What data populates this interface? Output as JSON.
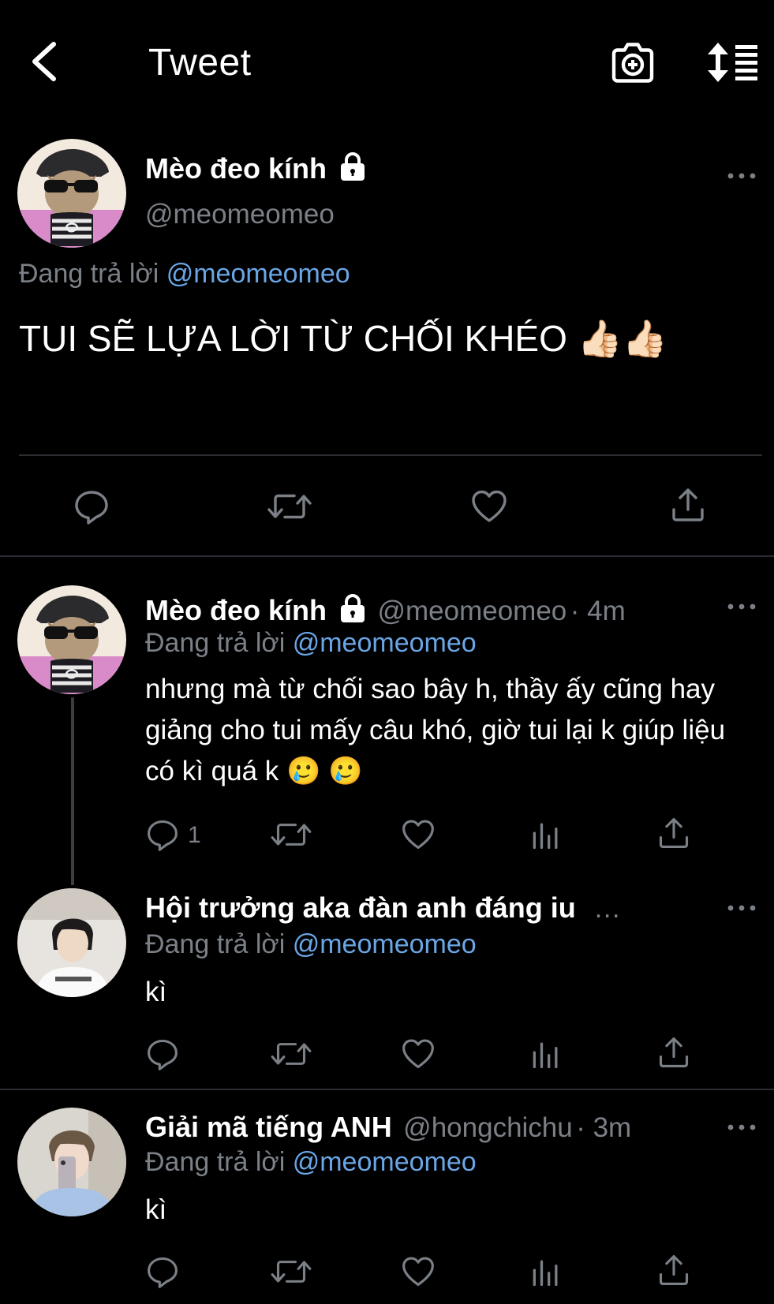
{
  "header": {
    "title": "Tweet"
  },
  "main_tweet": {
    "display_name": "Mèo đeo kính",
    "handle": "@meomeomeo",
    "reply_prefix": "Đang trả lời",
    "reply_to": "@meomeomeo",
    "text": "TUI SẼ LỰA LỜI TỪ CHỐI KHÉO 👍🏻👍🏻"
  },
  "replies": [
    {
      "display_name": "Mèo đeo kính",
      "handle": "@meomeomeo",
      "time": "· 4m",
      "reply_prefix": "Đang trả lời",
      "reply_to": "@meomeomeo",
      "text": "nhưng mà từ chối sao bây h, thầy ấy cũng hay giảng cho tui mấy câu khó, giờ tui lại k giúp liệu có kì quá k 🥲 🥲",
      "reply_count": "1"
    },
    {
      "display_name": "Hội trưởng aka đàn anh đáng iu",
      "truncation": "…",
      "reply_prefix": "Đang trả lời",
      "reply_to": "@meomeomeo",
      "text": "kì"
    },
    {
      "display_name": "Giải mã tiếng ANH",
      "handle": "@hongchichu",
      "time": "· 3m",
      "reply_prefix": "Đang trả lời",
      "reply_to": "@meomeomeo",
      "text": "kì"
    }
  ],
  "icons": [
    "back-icon",
    "camera-add-icon",
    "sort-icon",
    "lock-icon",
    "more-icon",
    "reply-icon",
    "retweet-icon",
    "like-icon",
    "share-icon",
    "analytics-icon"
  ],
  "colors": {
    "background": "#000000",
    "link": "#6aa6e6",
    "muted": "#7b8087",
    "divider": "#2a2d31"
  }
}
